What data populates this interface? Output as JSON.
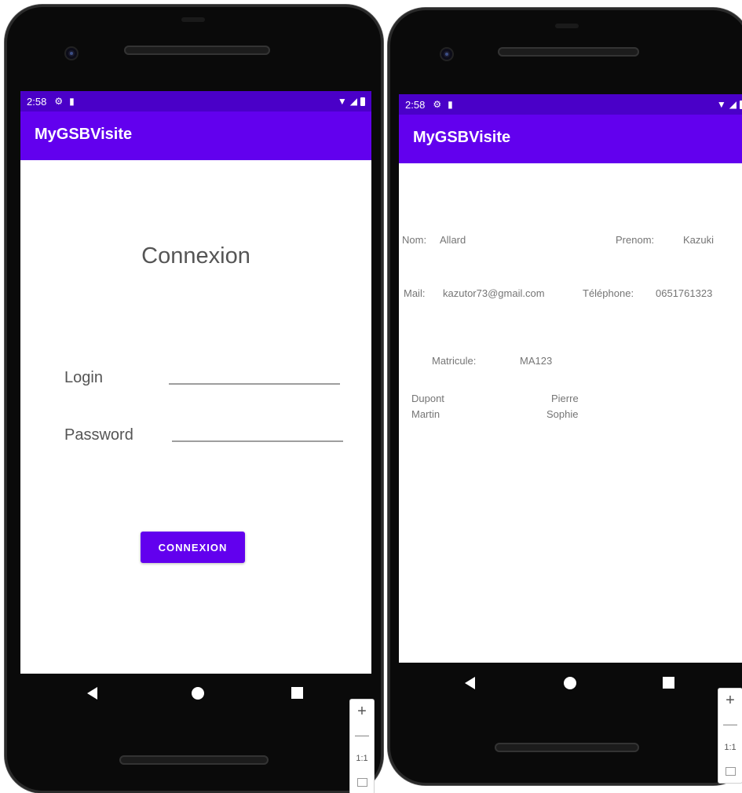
{
  "left_phone": {
    "status": {
      "time": "2:58",
      "gear_icon": "gear-icon",
      "sd_icon": "sd-card-icon",
      "wifi_icon": "wifi-icon",
      "signal_icon": "signal-icon",
      "battery_icon": "battery-icon"
    },
    "app_title": "MyGSBVisite",
    "heading": "Connexion",
    "login_label": "Login",
    "login_value": "",
    "password_label": "Password",
    "password_value": "",
    "connect_button": "CONNEXION"
  },
  "right_phone": {
    "status": {
      "time": "2:58"
    },
    "app_title": "MyGSBVisite",
    "nom_label": "Nom:",
    "nom_value": "Allard",
    "prenom_label": "Prenom:",
    "prenom_value": "Kazuki",
    "mail_label": "Mail:",
    "mail_value": "kazutor73@gmail.com",
    "tel_label": "Téléphone:",
    "tel_value": "0651761323",
    "matricule_label": "Matricule:",
    "matricule_value": "MA123",
    "list": [
      {
        "nom": "Dupont",
        "prenom": "Pierre"
      },
      {
        "nom": "Martin",
        "prenom": "Sophie"
      }
    ]
  },
  "zoom_controls": {
    "plus": "+",
    "minus": "—",
    "one_to_one": "1:1"
  },
  "colors": {
    "primary": "#6200ee",
    "status_bar": "#4a00c8",
    "label_text": "#757575"
  }
}
